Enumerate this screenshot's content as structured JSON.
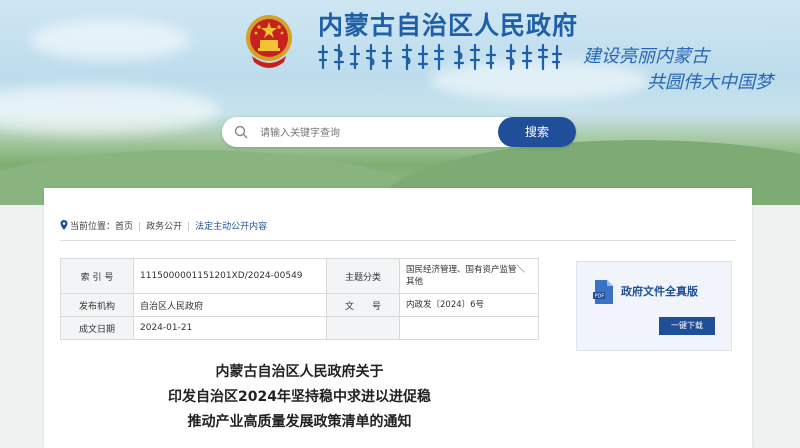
{
  "header": {
    "site_title": "内蒙古自治区人民政府",
    "slogan_line1": "建设亮丽内蒙古",
    "slogan_line2": "共圆伟大中国梦"
  },
  "search": {
    "placeholder": "请输入关键字查询",
    "button_label": "搜索"
  },
  "breadcrumb": {
    "prefix": "当前位置：",
    "items": [
      "首页",
      "政务公开",
      "法定主动公开内容"
    ]
  },
  "metadata": {
    "rows": [
      {
        "k1": "索 引 号",
        "v1": "1115000001151201XD/2024-00549",
        "k2": "主题分类",
        "v2": "国民经济管理、国有资产监管＼其他"
      },
      {
        "k1": "发布机构",
        "v1": "自治区人民政府",
        "k2": "文　　号",
        "v2": "内政发〔2024〕6号"
      },
      {
        "k1": "成文日期",
        "v1": "2024-01-21",
        "k2": "",
        "v2": ""
      }
    ]
  },
  "document": {
    "title_line1": "内蒙古自治区人民政府关于",
    "title_line2": "印发自治区2024年坚持稳中求进以进促稳",
    "title_line3": "推动产业高质量发展政策清单的通知"
  },
  "side_card": {
    "title": "政府文件全真版",
    "button_label": "一键下载"
  },
  "colors": {
    "brand_blue": "#1e4f98",
    "title_blue": "#1f5fa8"
  },
  "icons": {
    "emblem": "national-emblem-icon",
    "search": "search-icon",
    "breadcrumb": "location-pin-icon",
    "file": "pdf-file-icon"
  }
}
